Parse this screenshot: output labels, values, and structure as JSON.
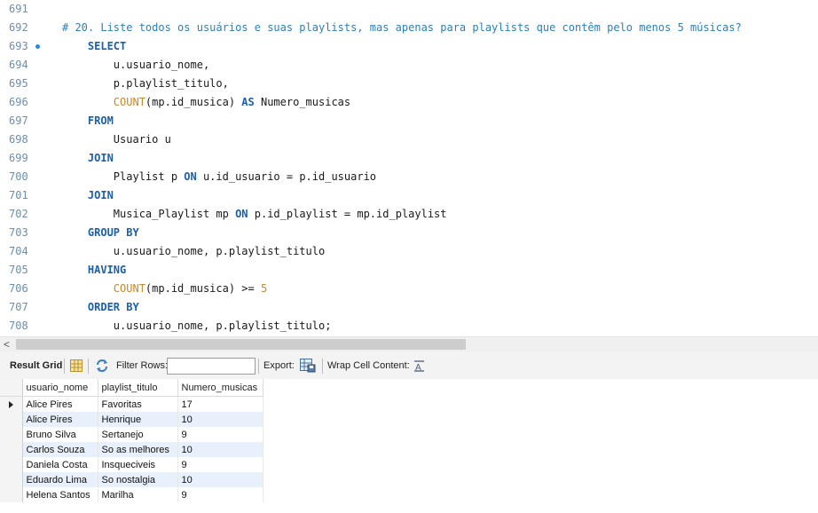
{
  "editor": {
    "lines": [
      {
        "num": "691",
        "tokens": []
      },
      {
        "num": "692",
        "tokens": [
          {
            "c": "comment",
            "t": "# 20. Liste todos os usuários e suas playlists, mas apenas para playlists que contêm pelo menos 5 músicas?"
          }
        ]
      },
      {
        "num": "693",
        "marker": true,
        "tokens": [
          {
            "c": "txt",
            "t": "    "
          },
          {
            "c": "kw",
            "t": "SELECT"
          }
        ]
      },
      {
        "num": "694",
        "tokens": [
          {
            "c": "txt",
            "t": "        u.usuario_nome,"
          }
        ]
      },
      {
        "num": "695",
        "tokens": [
          {
            "c": "txt",
            "t": "        p.playlist_titulo,"
          }
        ]
      },
      {
        "num": "696",
        "tokens": [
          {
            "c": "txt",
            "t": "        "
          },
          {
            "c": "fn",
            "t": "COUNT"
          },
          {
            "c": "txt",
            "t": "(mp.id_musica) "
          },
          {
            "c": "kw",
            "t": "AS"
          },
          {
            "c": "txt",
            "t": " Numero_musicas"
          }
        ]
      },
      {
        "num": "697",
        "tokens": [
          {
            "c": "txt",
            "t": "    "
          },
          {
            "c": "kw",
            "t": "FROM"
          }
        ]
      },
      {
        "num": "698",
        "tokens": [
          {
            "c": "txt",
            "t": "        Usuario u"
          }
        ]
      },
      {
        "num": "699",
        "tokens": [
          {
            "c": "txt",
            "t": "    "
          },
          {
            "c": "kw",
            "t": "JOIN"
          }
        ]
      },
      {
        "num": "700",
        "tokens": [
          {
            "c": "txt",
            "t": "        Playlist p "
          },
          {
            "c": "kw",
            "t": "ON"
          },
          {
            "c": "txt",
            "t": " u.id_usuario = p.id_usuario"
          }
        ]
      },
      {
        "num": "701",
        "tokens": [
          {
            "c": "txt",
            "t": "    "
          },
          {
            "c": "kw",
            "t": "JOIN"
          }
        ]
      },
      {
        "num": "702",
        "tokens": [
          {
            "c": "txt",
            "t": "        Musica_Playlist mp "
          },
          {
            "c": "kw",
            "t": "ON"
          },
          {
            "c": "txt",
            "t": " p.id_playlist = mp.id_playlist"
          }
        ]
      },
      {
        "num": "703",
        "tokens": [
          {
            "c": "txt",
            "t": "    "
          },
          {
            "c": "kw",
            "t": "GROUP BY"
          }
        ]
      },
      {
        "num": "704",
        "tokens": [
          {
            "c": "txt",
            "t": "        u.usuario_nome, p.playlist_titulo"
          }
        ]
      },
      {
        "num": "705",
        "tokens": [
          {
            "c": "txt",
            "t": "    "
          },
          {
            "c": "kw",
            "t": "HAVING"
          }
        ]
      },
      {
        "num": "706",
        "tokens": [
          {
            "c": "txt",
            "t": "        "
          },
          {
            "c": "fn",
            "t": "COUNT"
          },
          {
            "c": "txt",
            "t": "(mp.id_musica) >= "
          },
          {
            "c": "num",
            "t": "5"
          }
        ]
      },
      {
        "num": "707",
        "tokens": [
          {
            "c": "txt",
            "t": "    "
          },
          {
            "c": "kw",
            "t": "ORDER BY"
          }
        ]
      },
      {
        "num": "708",
        "tokens": [
          {
            "c": "txt",
            "t": "        u.usuario_nome, p.playlist_titulo;"
          }
        ]
      }
    ]
  },
  "scrollbar": {
    "left_arrow": "<"
  },
  "toolbar": {
    "result_grid": "Result Grid",
    "filter_rows": "Filter Rows:",
    "filter_value": "",
    "export": "Export:",
    "wrap_cell_content": "Wrap Cell Content:"
  },
  "grid": {
    "columns": [
      "usuario_nome",
      "playlist_titulo",
      "Numero_musicas"
    ],
    "rows": [
      [
        "Alice Pires",
        "Favoritas",
        "17"
      ],
      [
        "Alice Pires",
        "Henrique",
        "10"
      ],
      [
        "Bruno Silva",
        "Sertanejo",
        "9"
      ],
      [
        "Carlos Souza",
        "So as melhores",
        "10"
      ],
      [
        "Daniela Costa",
        "Insqueciveis",
        "9"
      ],
      [
        "Eduardo Lima",
        "So nostalgia",
        "10"
      ],
      [
        "Helena Santos",
        "Marilha",
        "9"
      ]
    ],
    "current_row": 0
  },
  "colors": {
    "keyword": "#1b5fa8",
    "comment": "#2d7fb5",
    "function": "#c58a2c",
    "alt_row": "#e8f0fb"
  }
}
